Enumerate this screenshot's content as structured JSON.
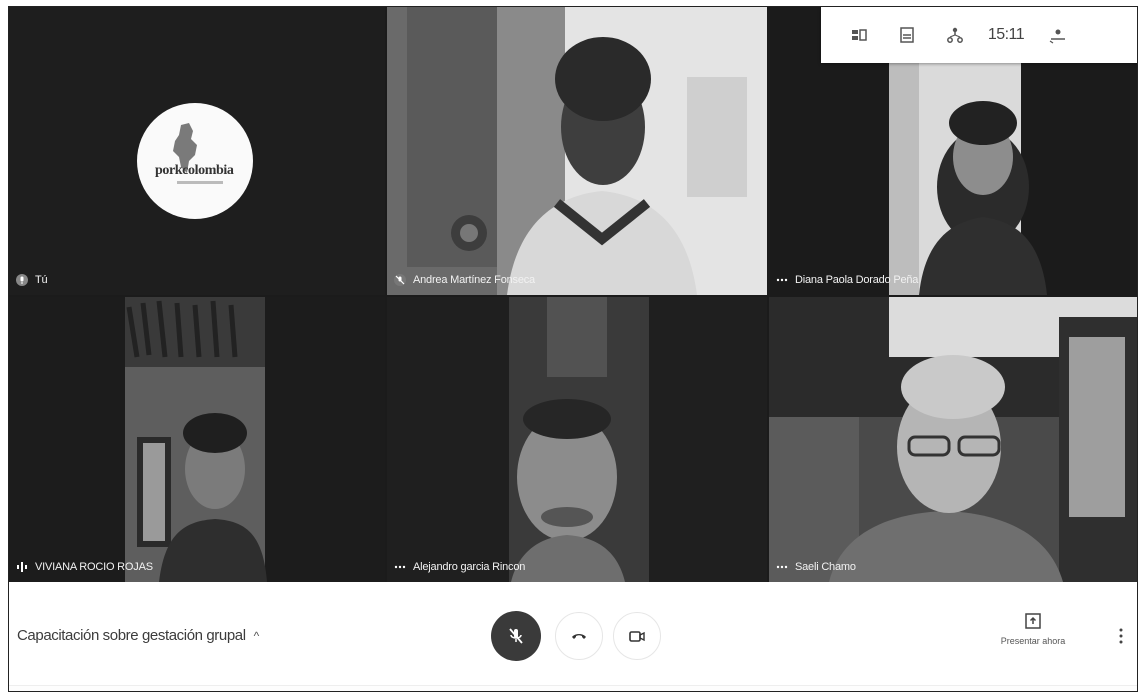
{
  "tray": {
    "clock": "15:11"
  },
  "participants": [
    {
      "name": "Tú",
      "status": "speaker"
    },
    {
      "name": "Andrea Martínez Fonseca",
      "status": "muted"
    },
    {
      "name": "Diana Paola Dorado Peña",
      "status": "more"
    },
    {
      "name": "VIVIANA ROCIO ROJAS",
      "status": "speaking"
    },
    {
      "name": "Alejandro garcia Rincon",
      "status": "more"
    },
    {
      "name": "Saeli Chamo",
      "status": "more"
    }
  ],
  "logo": {
    "wordmark": "porkcolombia"
  },
  "bar": {
    "meeting_title": "Capacitación sobre gestación grupal",
    "present_label": "Presentar ahora"
  }
}
